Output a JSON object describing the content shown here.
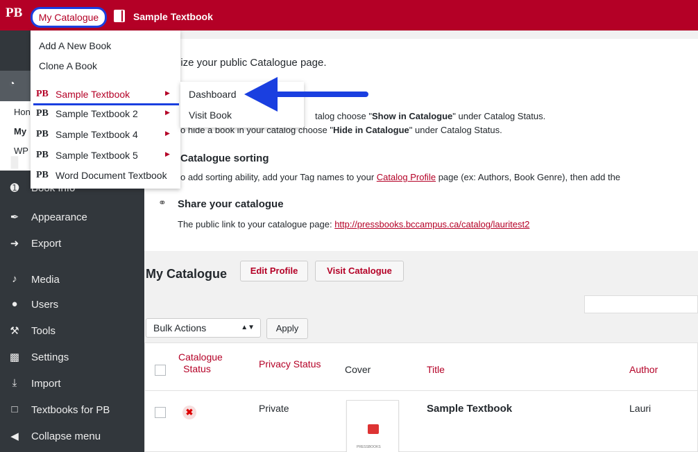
{
  "adminbar": {
    "logo": "PB",
    "my_catalogue": "My Catalogue",
    "book_title": "Sample Textbook"
  },
  "sidebar": {
    "sub_items": [
      "Hon",
      "My",
      "WP"
    ],
    "items": [
      {
        "label": "Book Info",
        "icon": "info-icon"
      },
      {
        "label": "Appearance",
        "icon": "brush-icon"
      },
      {
        "label": "Export",
        "icon": "export-icon"
      },
      {
        "label": "Media",
        "icon": "media-icon"
      },
      {
        "label": "Users",
        "icon": "users-icon"
      },
      {
        "label": "Tools",
        "icon": "wrench-icon"
      },
      {
        "label": "Settings",
        "icon": "settings-icon"
      },
      {
        "label": "Import",
        "icon": "import-icon"
      },
      {
        "label": "Textbooks for PB",
        "icon": "textbooks-icon"
      },
      {
        "label": "Collapse menu",
        "icon": "collapse-icon"
      }
    ]
  },
  "notice": {
    "intro": "nize your public Catalogue page.",
    "show_line_a": "talog choose ",
    "show_line_b": "Show in Catalogue",
    "show_line_c": "\" under Catalog Status.",
    "hide_line_a": "o hide a book in your catalog choose \"",
    "hide_line_b": "Hide in Catalogue",
    "hide_line_c": "\" under Catalog Status.",
    "sorting_heading": "Catalogue sorting",
    "sorting_text_a": "o add sorting ability, add your Tag names to your ",
    "sorting_link": "Catalog Profile",
    "sorting_text_b": " page (ex: Authors, Book Genre), then add the",
    "share_heading": "Share your catalogue",
    "share_text": "The public link to your catalogue page: ",
    "share_link": "http://pressbooks.bccampus.ca/catalog/lauritest2"
  },
  "catalogue": {
    "title": "My Catalogue",
    "edit_profile": "Edit Profile",
    "visit_catalogue": "Visit Catalogue",
    "bulk_actions": "Bulk Actions",
    "apply": "Apply"
  },
  "table": {
    "headers": {
      "status_line1": "Catalogue",
      "status_line2": "Status",
      "privacy": "Privacy Status",
      "cover": "Cover",
      "title": "Title",
      "author": "Author"
    },
    "rows": [
      {
        "privacy": "Private",
        "title": "Sample Textbook",
        "author": "Lauri",
        "cover_text": "PRESSBOOKS"
      }
    ]
  },
  "menu": {
    "add_new_book": "Add A New Book",
    "clone_book": "Clone A Book",
    "pb_mark": "PB",
    "books": [
      "Sample Textbook",
      "Sample Textbook 2",
      "Sample Textbook 4",
      "Sample Textbook 5",
      "Word Document Textbook"
    ]
  },
  "submenu": {
    "dashboard": "Dashboard",
    "visit_book": "Visit Book"
  },
  "colors": {
    "brand_red": "#b40026",
    "highlight_blue": "#1a3fe0",
    "sidebar_bg": "#32373c"
  }
}
